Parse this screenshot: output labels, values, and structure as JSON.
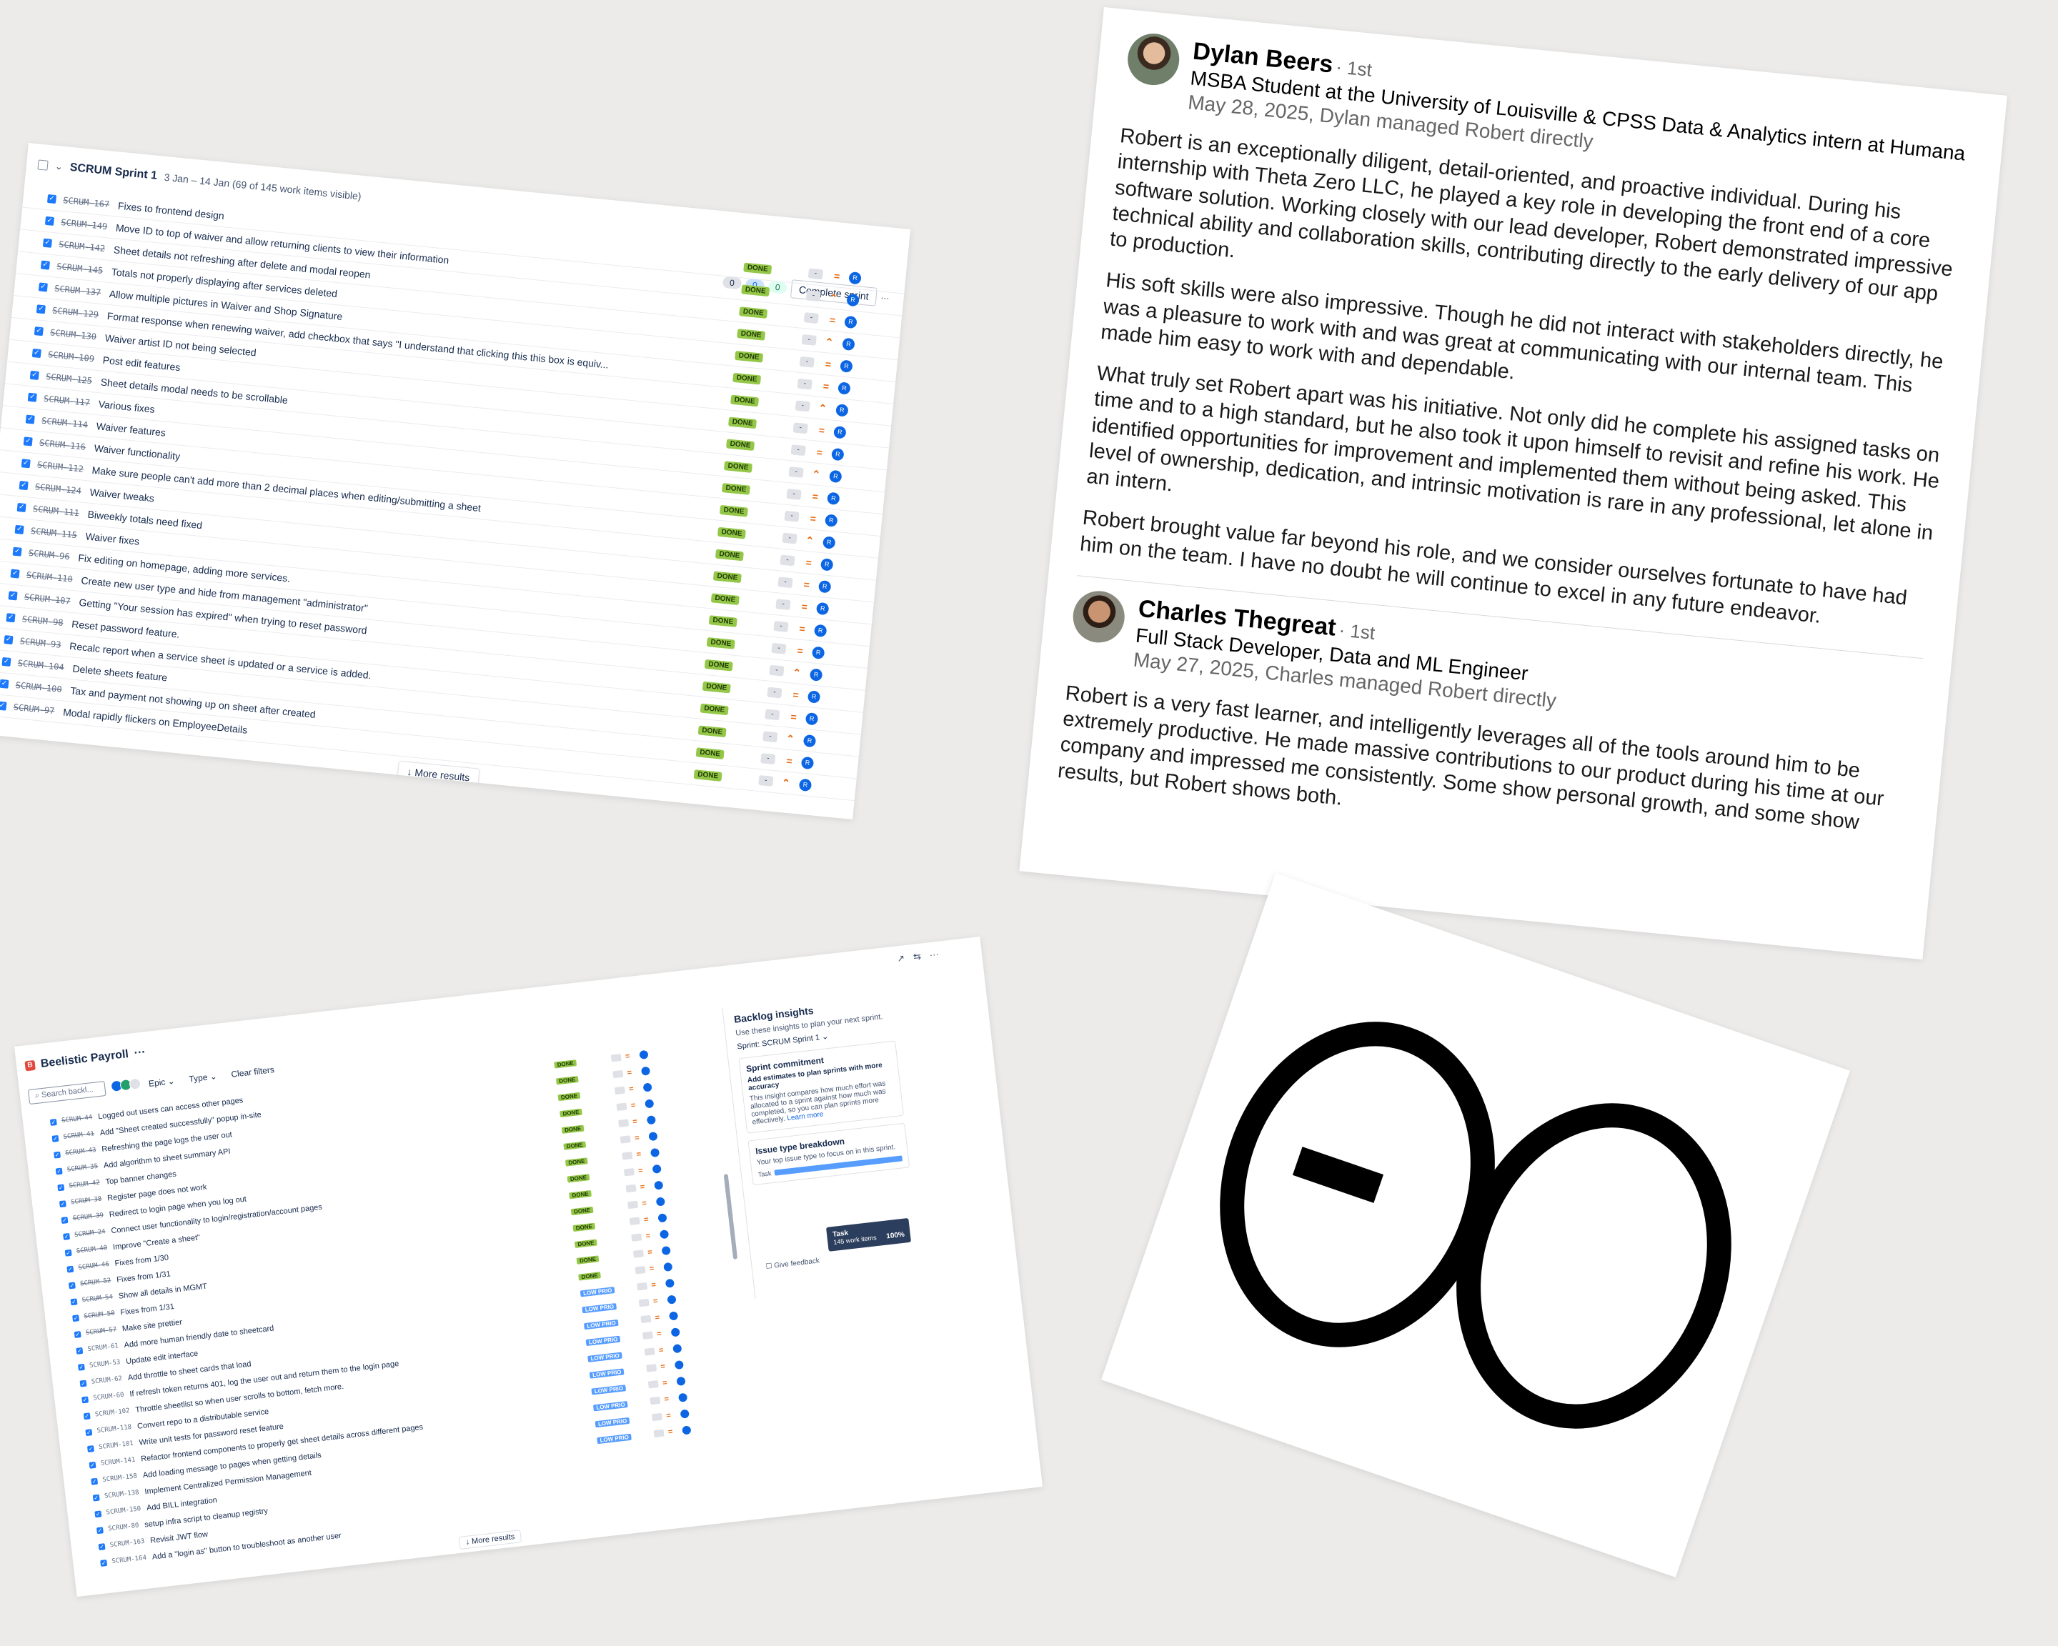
{
  "sprint": {
    "name": "SCRUM Sprint 1",
    "meta": "3 Jan – 14 Jan (69 of 145 work items visible)",
    "counts": [
      "0",
      "0",
      "0"
    ],
    "complete_label": "Complete sprint",
    "more_label": "More results",
    "status_label": "DONE",
    "items": [
      {
        "key": "SCRUM-167",
        "summary": "Fixes to frontend design"
      },
      {
        "key": "SCRUM-149",
        "summary": "Move ID to top of waiver and allow returning clients to view their information"
      },
      {
        "key": "SCRUM-142",
        "summary": "Sheet details not refreshing after delete and modal reopen"
      },
      {
        "key": "SCRUM-145",
        "summary": "Totals not properly displaying after services deleted"
      },
      {
        "key": "SCRUM-137",
        "summary": "Allow multiple pictures in Waiver and Shop Signature"
      },
      {
        "key": "SCRUM-129",
        "summary": "Format response when renewing waiver, add checkbox that says \"I understand that clicking this this box is equiv..."
      },
      {
        "key": "SCRUM-130",
        "summary": "Waiver artist ID not being selected"
      },
      {
        "key": "SCRUM-109",
        "summary": "Post edit features"
      },
      {
        "key": "SCRUM-125",
        "summary": "Sheet details modal needs to be scrollable"
      },
      {
        "key": "SCRUM-117",
        "summary": "Various fixes"
      },
      {
        "key": "SCRUM-114",
        "summary": "Waiver features"
      },
      {
        "key": "SCRUM-116",
        "summary": "Waiver functionality"
      },
      {
        "key": "SCRUM-112",
        "summary": "Make sure people can't add more than 2 decimal places when editing/submitting a sheet"
      },
      {
        "key": "SCRUM-124",
        "summary": "Waiver tweaks"
      },
      {
        "key": "SCRUM-111",
        "summary": "Biweekly totals need fixed"
      },
      {
        "key": "SCRUM-115",
        "summary": "Waiver fixes"
      },
      {
        "key": "SCRUM-96",
        "summary": "Fix editing on homepage, adding more services."
      },
      {
        "key": "SCRUM-110",
        "summary": "Create new user type and hide from management \"administrator\""
      },
      {
        "key": "SCRUM-107",
        "summary": "Getting \"Your session has expired\" when trying to reset password"
      },
      {
        "key": "SCRUM-98",
        "summary": "Reset password feature."
      },
      {
        "key": "SCRUM-93",
        "summary": "Recalc report when a service sheet is updated or a service is added."
      },
      {
        "key": "SCRUM-104",
        "summary": "Delete sheets feature"
      },
      {
        "key": "SCRUM-100",
        "summary": "Tax and payment not showing up on sheet after created"
      },
      {
        "key": "SCRUM-97",
        "summary": "Modal rapidly flickers on EmployeeDetails"
      }
    ]
  },
  "backlog": {
    "project": "Beelistic Payroll",
    "search_placeholder": "Search backl...",
    "filter_epic": "Epic",
    "filter_type": "Type",
    "clear_filters": "Clear filters",
    "more_label": "More results",
    "status_done": "DONE",
    "status_low": "LOW PRIO",
    "items": [
      {
        "key": "SCRUM-44",
        "summary": "Logged out users can access other pages",
        "status": "done"
      },
      {
        "key": "SCRUM-41",
        "summary": "Add \"Sheet created successfully\" popup in-site",
        "status": "done"
      },
      {
        "key": "SCRUM-43",
        "summary": "Refreshing the page logs the user out",
        "status": "done"
      },
      {
        "key": "SCRUM-35",
        "summary": "Add algorithm to sheet summary API",
        "status": "done"
      },
      {
        "key": "SCRUM-42",
        "summary": "Top banner changes",
        "status": "done"
      },
      {
        "key": "SCRUM-38",
        "summary": "Register page does not work",
        "status": "done"
      },
      {
        "key": "SCRUM-39",
        "summary": "Redirect to login page when you log out",
        "status": "done"
      },
      {
        "key": "SCRUM-24",
        "summary": "Connect user functionality to login/registration/account pages",
        "status": "done"
      },
      {
        "key": "SCRUM-40",
        "summary": "Improve \"Create a sheet\"",
        "status": "done"
      },
      {
        "key": "SCRUM-46",
        "summary": "Fixes from 1/30",
        "status": "done"
      },
      {
        "key": "SCRUM-52",
        "summary": "Fixes from 1/31",
        "status": "done"
      },
      {
        "key": "SCRUM-54",
        "summary": "Show all details in MGMT",
        "status": "done"
      },
      {
        "key": "SCRUM-50",
        "summary": "Fixes from 1/31",
        "status": "done"
      },
      {
        "key": "SCRUM-57",
        "summary": "Make site prettier",
        "status": "done"
      },
      {
        "key": "SCRUM-61",
        "summary": "Add more human friendly date to sheetcard",
        "status": "low"
      },
      {
        "key": "SCRUM-53",
        "summary": "Update edit interface",
        "status": "low"
      },
      {
        "key": "SCRUM-62",
        "summary": "Add throttle to sheet cards that load",
        "status": "low"
      },
      {
        "key": "SCRUM-60",
        "summary": "If refresh token returns 401, log the user out and return them to the login page",
        "status": "low"
      },
      {
        "key": "SCRUM-102",
        "summary": "Throttle sheetlist so when user scrolls to bottom, fetch more.",
        "status": "low"
      },
      {
        "key": "SCRUM-118",
        "summary": "Convert repo to a distributable service",
        "status": "low"
      },
      {
        "key": "SCRUM-101",
        "summary": "Write unit tests for password reset feature",
        "status": "low"
      },
      {
        "key": "SCRUM-141",
        "summary": "Refactor frontend components to properly get sheet details across different pages",
        "status": "low"
      },
      {
        "key": "SCRUM-158",
        "summary": "Add loading message to pages when getting details",
        "status": "low"
      },
      {
        "key": "SCRUM-138",
        "summary": "Implement Centralized Permission Management",
        "status": "low"
      },
      {
        "key": "SCRUM-150",
        "summary": "Add BILL integration",
        "status": "none"
      },
      {
        "key": "SCRUM-80",
        "summary": "setup infra script to cleanup registry",
        "status": "none"
      },
      {
        "key": "SCRUM-163",
        "summary": "Revisit JWT flow",
        "status": "none"
      },
      {
        "key": "SCRUM-164",
        "summary": "Add a \"login as\" button to troubleshoot as another user",
        "status": "none"
      }
    ],
    "insights": {
      "title": "Backlog insights",
      "subtitle": "Use these insights to plan your next sprint.",
      "sprint_label": "Sprint:",
      "sprint_value": "SCRUM Sprint 1",
      "commitment_title": "Sprint commitment",
      "commitment_strong": "Add estimates to plan sprints with more accuracy",
      "commitment_text": "This insight compares how much effort was allocated to a sprint against how much was completed, so you can plan sprints more effectively.",
      "learn_more": "Learn more",
      "breakdown_title": "Issue type breakdown",
      "breakdown_text": "Your top issue type to focus on in this sprint.",
      "bar_label": "Task",
      "tooltip_title": "Task",
      "tooltip_text": "145 work items",
      "tooltip_pct": "100%",
      "feedback": "Give feedback"
    }
  },
  "reco": [
    {
      "name": "Dylan Beers",
      "degree": "· 1st",
      "headline": "MSBA Student at the University of Louisville & CPSS Data & Analytics intern at Humana",
      "date": "May 28, 2025, Dylan managed Robert directly",
      "paragraphs": [
        "Robert is an exceptionally diligent, detail-oriented, and proactive individual. During his internship with Theta Zero LLC, he played a key role in developing the front end of a core software solution. Working closely with our lead developer, Robert demonstrated impressive technical ability and collaboration skills, contributing directly to the early delivery of our app to production.",
        "His soft skills were also impressive. Though he did not interact with stakeholders directly, he was a pleasure to work with and was great at communicating with our internal team. This made him easy to work with and dependable.",
        "What truly set Robert apart was his initiative. Not only did he complete his assigned tasks on time and to a high standard, but he also took it upon himself to revisit and refine his work. He identified opportunities for improvement and implemented them without being asked. This level of ownership, dedication, and intrinsic motivation is rare in any professional, let alone in an intern.",
        "Robert brought value far beyond his role, and we consider ourselves fortunate to have had him on the team. I have no doubt he will continue to excel in any future endeavor."
      ]
    },
    {
      "name": "Charles Thegreat",
      "degree": "· 1st",
      "headline": "Full Stack Developer, Data and ML Engineer",
      "date": "May 27, 2025, Charles managed Robert directly",
      "paragraphs": [
        "Robert is a very fast learner, and intelligently leverages all of the tools around him to be extremely productive. He made massive contributions to our product during his time at our company and impressed me consistently. Some show personal growth, and some show results, but Robert shows both."
      ]
    }
  ],
  "logo": {
    "icon": "theta-zero-logo"
  }
}
